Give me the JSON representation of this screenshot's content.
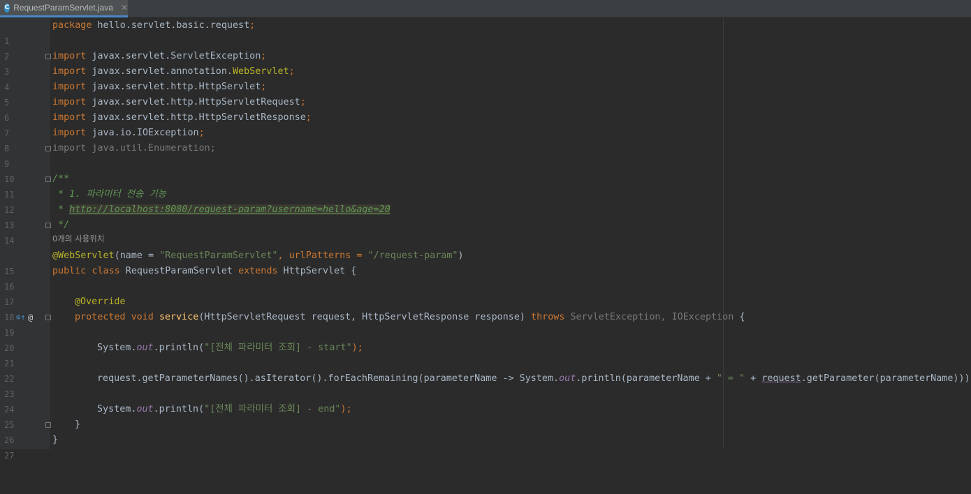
{
  "tab": {
    "title": "RequestParamServlet.java",
    "icon_letter": "C",
    "close_glyph": "✕"
  },
  "gutter_icons": {
    "override": "⊙↑",
    "annotation": "@"
  },
  "code": {
    "l1_kw": "package",
    "l1_rest": " hello.servlet.basic.request",
    "semi": ";",
    "imp": "import",
    "l3": " javax.servlet.ServletException",
    "l4a": " javax.servlet.annotation.",
    "l4b": "WebServlet",
    "l5": " javax.servlet.http.HttpServlet",
    "l6": " javax.servlet.http.HttpServletRequest",
    "l7": " javax.servlet.http.HttpServletResponse",
    "l8": " java.io.IOException",
    "l9": "import java.util.Enumeration;",
    "l11": "/**",
    "l12": " * 1. 파라미터 전송 기능",
    "l13a": " * ",
    "l13b": "http://localhost:8080/request-param?username=hello&age=20",
    "l14": " */",
    "hint": "0개의 사용위치",
    "l15_ann": "@WebServlet",
    "l15_a": "(name = ",
    "l15_s1": "\"RequestParamServlet\"",
    "l15_b": ", urlPatterns = ",
    "l15_s2": "\"/request-param\"",
    "l15_c": ")",
    "l16_kw1": "public class",
    "l16_a": " RequestParamServlet ",
    "l16_kw2": "extends",
    "l16_b": " HttpServlet {",
    "l18": "@Override",
    "l19_kw": "protected void",
    "l19_fn": "service",
    "l19_a": "(HttpServletRequest request, HttpServletResponse response) ",
    "l19_kw2": "throws",
    "l19_g": " ServletException, IOException",
    "l19_b": " {",
    "sys": "System.",
    "out": "out",
    "println": ".println(",
    "l21_s": "\"[전체 파라미터 조회] - start\"",
    "close": ");",
    "l23_a": "request.getParameterNames().asIterator().forEachRemaining(parameterName -> System.",
    "l23_b": ".println(parameterName + ",
    "l23_s": "\" = \"",
    "l23_c": " + ",
    "l23_u": "request",
    "l23_d": ".getParameter(parameterName)));",
    "l25_s": "\"[전체 파라미터 조회] - end\"",
    "l26": "}",
    "l27": "}"
  },
  "line_numbers": [
    "1",
    "2",
    "3",
    "4",
    "5",
    "6",
    "7",
    "8",
    "9",
    "10",
    "11",
    "12",
    "13",
    "14",
    "15",
    "16",
    "17",
    "18",
    "19",
    "20",
    "21",
    "22",
    "23",
    "24",
    "25",
    "26",
    "27"
  ]
}
